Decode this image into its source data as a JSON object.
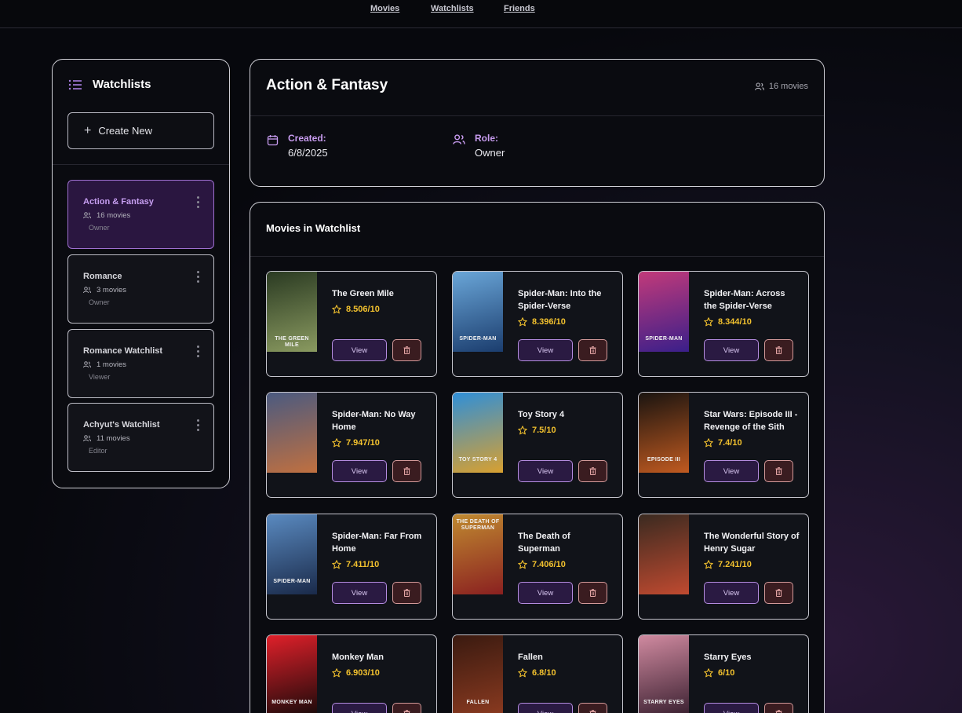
{
  "nav": {
    "movies": "Movies",
    "watchlists": "Watchlists",
    "friends": "Friends"
  },
  "sidebar": {
    "title": "Watchlists",
    "create_label": "Create New",
    "items": [
      {
        "name": "Action & Fantasy",
        "count": "16 movies",
        "role": "Owner"
      },
      {
        "name": "Romance",
        "count": "3 movies",
        "role": "Owner"
      },
      {
        "name": "Romance Watchlist",
        "count": "1 movies",
        "role": "Viewer"
      },
      {
        "name": "Achyut's Watchlist",
        "count": "11 movies",
        "role": "Editor"
      }
    ]
  },
  "detail": {
    "title": "Action & Fantasy",
    "count": "16 movies",
    "created_label": "Created:",
    "created_value": "6/8/2025",
    "role_label": "Role:",
    "role_value": "Owner"
  },
  "movies_section": {
    "title": "Movies in Watchlist",
    "view_label": "View",
    "items": [
      {
        "title": "The Green Mile",
        "rating": "8.506/10",
        "poster_text": "THE GREEN MILE",
        "poster_colors": [
          "#2a3a22",
          "#8a9a60"
        ]
      },
      {
        "title": "Spider-Man: Into the Spider-Verse",
        "rating": "8.396/10",
        "poster_text": "SPIDER-MAN",
        "poster_colors": [
          "#6aa6d8",
          "#1b3d6e"
        ]
      },
      {
        "title": "Spider-Man: Across the Spider-Verse",
        "rating": "8.344/10",
        "poster_text": "SPIDER-MAN",
        "poster_colors": [
          "#c23a7a",
          "#3a1f8a"
        ]
      },
      {
        "title": "Spider-Man: No Way Home",
        "rating": "7.947/10",
        "poster_text": "",
        "poster_colors": [
          "#4a5a80",
          "#c07040"
        ]
      },
      {
        "title": "Toy Story 4",
        "rating": "7.5/10",
        "poster_text": "TOY STORY 4",
        "poster_colors": [
          "#2f8fd8",
          "#d8a030"
        ]
      },
      {
        "title": "Star Wars: Episode III - Revenge of the Sith",
        "rating": "7.4/10",
        "poster_text": "EPISODE III",
        "poster_colors": [
          "#1a1410",
          "#c05a20"
        ]
      },
      {
        "title": "Spider-Man: Far From Home",
        "rating": "7.411/10",
        "poster_text": "SPIDER-MAN",
        "poster_colors": [
          "#5a8ac0",
          "#1a2a4a"
        ]
      },
      {
        "title": "The Death of Superman",
        "rating": "7.406/10",
        "poster_text": "THE DEATH OF SUPERMAN",
        "poster_colors": [
          "#c08a30",
          "#8a2020"
        ]
      },
      {
        "title": "The Wonderful Story of Henry Sugar",
        "rating": "7.241/10",
        "poster_text": "",
        "poster_colors": [
          "#3a2a20",
          "#c04a30"
        ]
      },
      {
        "title": "Monkey Man",
        "rating": "6.903/10",
        "poster_text": "MONKEY MAN",
        "poster_colors": [
          "#e0202a",
          "#1a0a0a"
        ]
      },
      {
        "title": "Fallen",
        "rating": "6.8/10",
        "poster_text": "FALLEN",
        "poster_colors": [
          "#3a1a10",
          "#8a3a20"
        ]
      },
      {
        "title": "Starry Eyes",
        "rating": "6/10",
        "poster_text": "STARRY EYES",
        "poster_colors": [
          "#d08aa0",
          "#3a2030"
        ]
      }
    ]
  },
  "colors": {
    "accent": "#c89cf0",
    "star": "#f2c12e",
    "active_bg": "#2a1640"
  }
}
